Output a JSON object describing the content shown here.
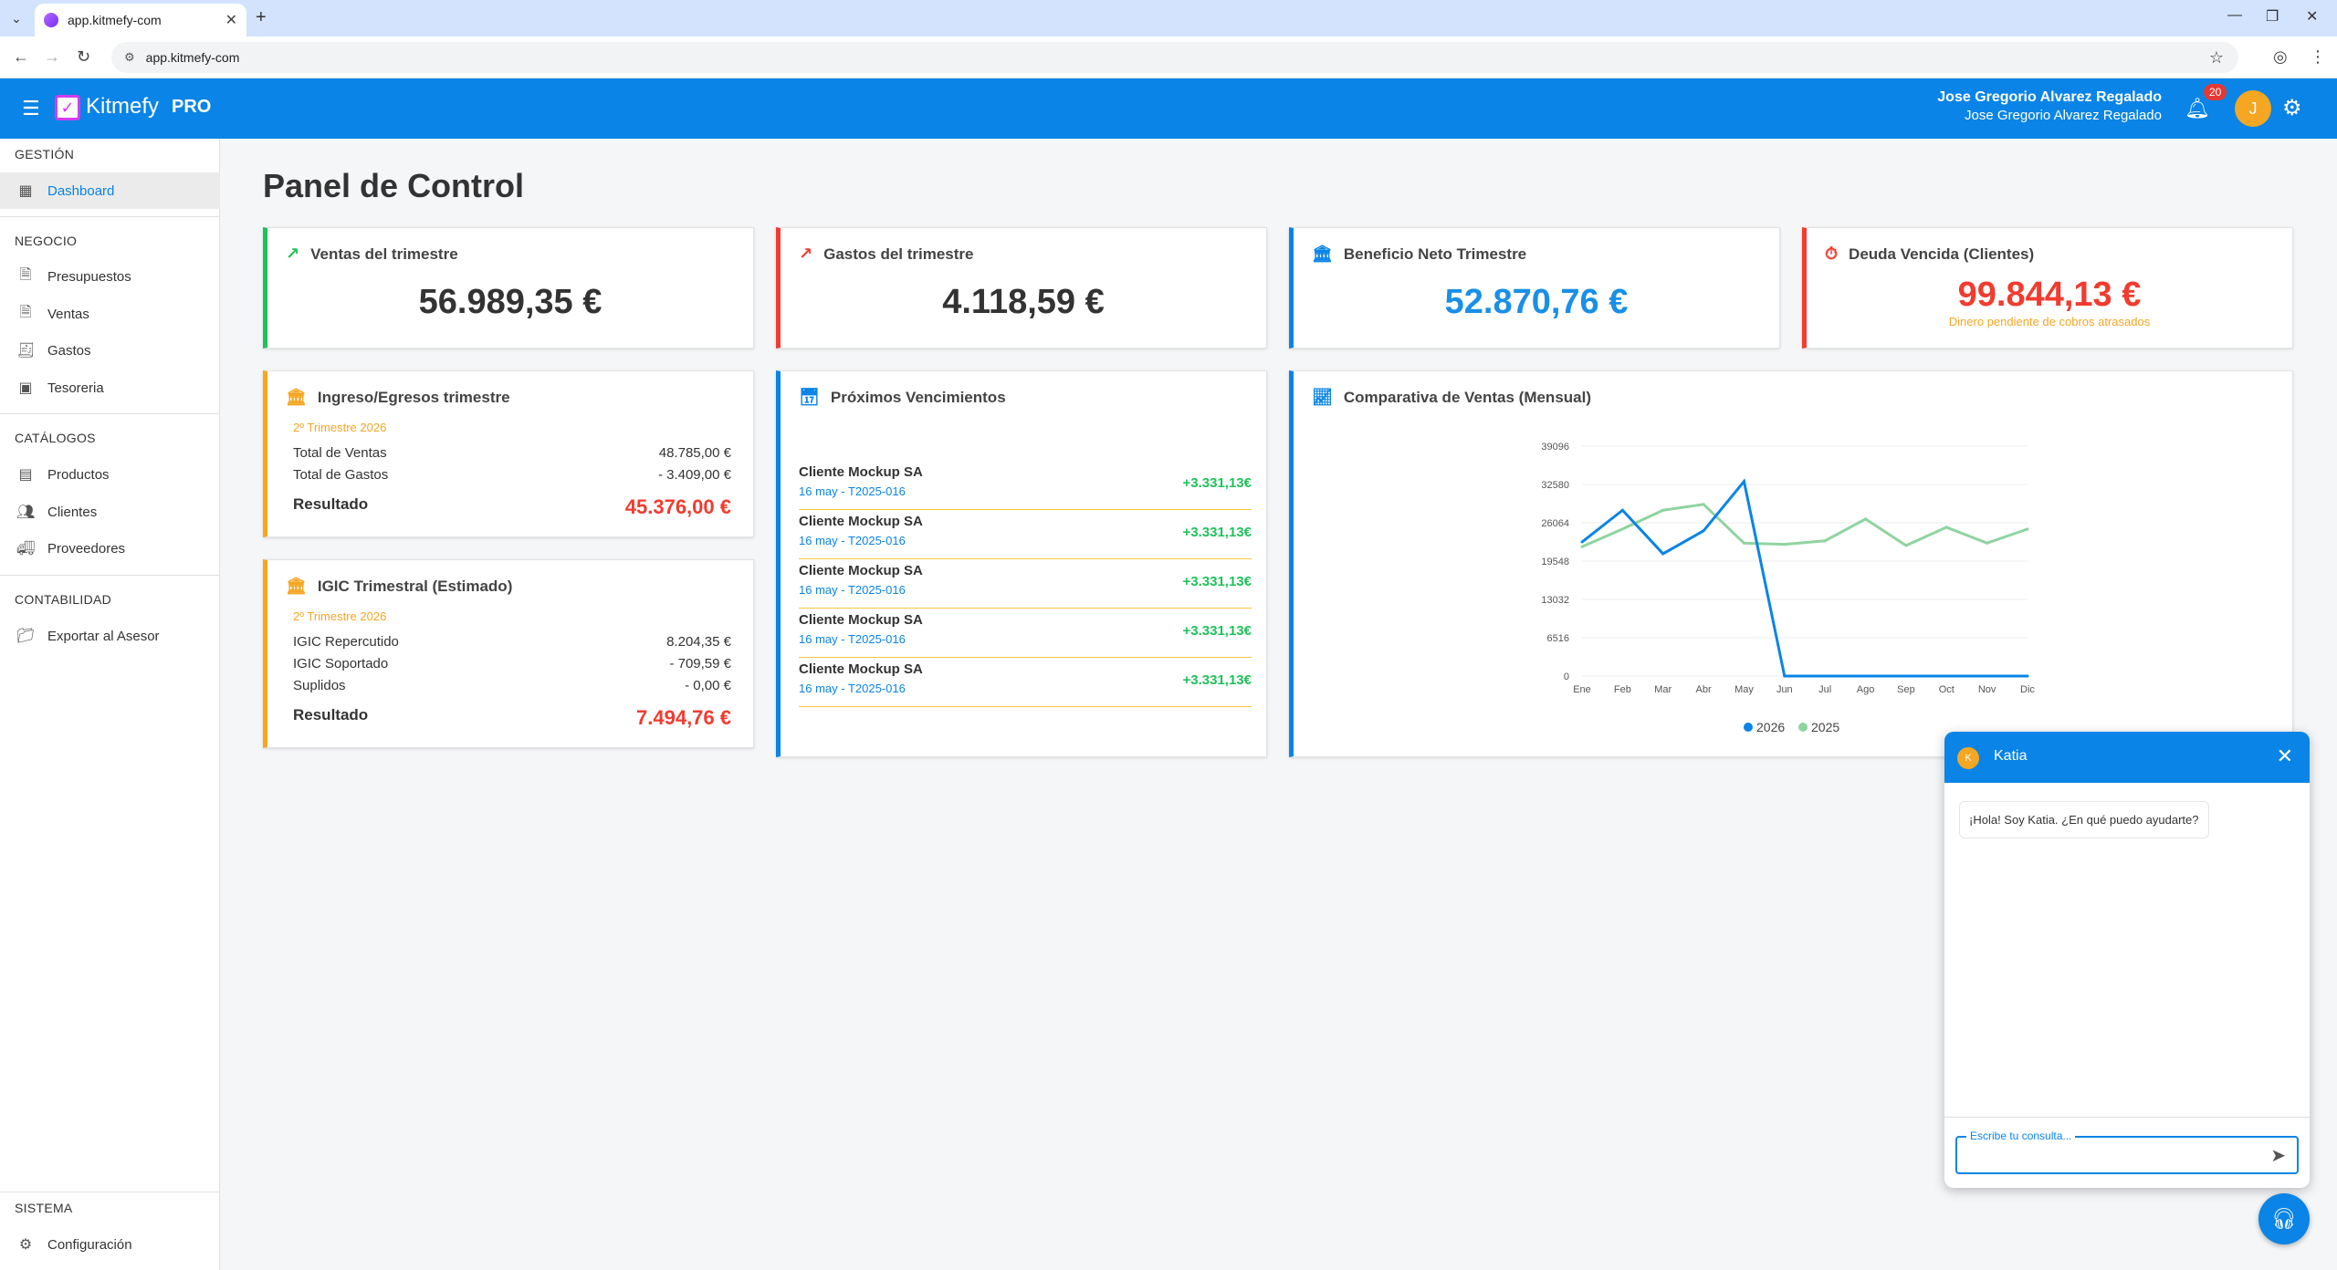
{
  "browser": {
    "tab_title": "app.kitmefy-com",
    "url": "app.kitmefy-com",
    "new_tab": "+",
    "tab_close": "✕"
  },
  "header": {
    "brand": "Kitmefy",
    "pro": "PRO",
    "user_name": "Jose Gregorio Alvarez Regalado",
    "user_sub": "Jose Gregorio Alvarez Regalado",
    "notifications": "20",
    "avatar_letter": "J"
  },
  "sidebar": {
    "sections": {
      "gestion": "GESTIÓN",
      "negocio": "NEGOCIO",
      "catalogos": "CATÁLOGOS",
      "contabilidad": "CONTABILIDAD",
      "sistema": "SISTEMA"
    },
    "items": {
      "dashboard": "Dashboard",
      "presupuestos": "Presupuestos",
      "ventas": "Ventas",
      "gastos": "Gastos",
      "tesoreria": "Tesoreria",
      "productos": "Productos",
      "clientes": "Clientes",
      "proveedores": "Proveedores",
      "exportar": "Exportar al Asesor",
      "configuracion": "Configuración"
    }
  },
  "main": {
    "title": "Panel de Control",
    "kpis": {
      "ventas": {
        "label": "Ventas del trimestre",
        "value": "56.989,35 €"
      },
      "gastos": {
        "label": "Gastos del trimestre",
        "value": "4.118,59 €"
      },
      "beneficio": {
        "label": "Beneficio Neto Trimestre",
        "value": "52.870,76 €"
      },
      "deuda": {
        "label": "Deuda Vencida (Clientes)",
        "value": "99.844,13 €",
        "sub": "Dinero pendiente de cobros atrasados"
      }
    },
    "ingresos": {
      "title": "Ingreso/Egresos trimestre",
      "period": "2º Trimestre 2026",
      "rows": [
        {
          "label": "Total de Ventas",
          "value": "48.785,00 €"
        },
        {
          "label": "Total de Gastos",
          "value": "- 3.409,00 €"
        }
      ],
      "total_label": "Resultado",
      "total_value": "45.376,00 €"
    },
    "igic": {
      "title": "IGIC Trimestral (Estimado)",
      "period": "2º Trimestre 2026",
      "rows": [
        {
          "label": "IGIC Repercutido",
          "value": "8.204,35 €"
        },
        {
          "label": "IGIC Soportado",
          "value": "- 709,59 €"
        },
        {
          "label": "Suplidos",
          "value": "- 0,00 €"
        }
      ],
      "total_label": "Resultado",
      "total_value": "7.494,76 €"
    },
    "vencimientos": {
      "title": "Próximos Vencimientos",
      "items": [
        {
          "name": "Cliente Mockup SA",
          "date": "16 may - T2025-016",
          "amount": "+3.331,13€"
        },
        {
          "name": "Cliente Mockup SA",
          "date": "16 may - T2025-016",
          "amount": "+3.331,13€"
        },
        {
          "name": "Cliente Mockup SA",
          "date": "16 may - T2025-016",
          "amount": "+3.331,13€"
        },
        {
          "name": "Cliente Mockup SA",
          "date": "16 may - T2025-016",
          "amount": "+3.331,13€"
        },
        {
          "name": "Cliente Mockup SA",
          "date": "16 may - T2025-016",
          "amount": "+3.331,13€"
        }
      ]
    },
    "chart_title": "Comparativa de Ventas (Mensual)"
  },
  "chart_data": {
    "type": "line",
    "title": "Comparativa de Ventas (Mensual)",
    "categories": [
      "Ene",
      "Feb",
      "Mar",
      "Abr",
      "May",
      "Jun",
      "Jul",
      "Ago",
      "Sep",
      "Oct",
      "Nov",
      "Dic"
    ],
    "yticks": [
      0,
      6516,
      13032,
      19548,
      26064,
      32580,
      39096
    ],
    "ylim": [
      0,
      39096
    ],
    "series": [
      {
        "name": "2026",
        "color": "#0a84e6",
        "values": [
          22800,
          28200,
          20800,
          24700,
          33100,
          0,
          0,
          0,
          0,
          0,
          0,
          0
        ]
      },
      {
        "name": "2025",
        "color": "#8fd4a0",
        "values": [
          22000,
          25000,
          28200,
          29200,
          22600,
          22400,
          23000,
          26700,
          22200,
          25300,
          22600,
          25000
        ]
      }
    ],
    "legend": "bottom"
  },
  "chat": {
    "name": "Katia",
    "avatar_letter": "K",
    "message": "¡Hola! Soy Katia. ¿En qué puedo ayudarte?",
    "input_label": "Escribe tu consulta..."
  },
  "colors": {
    "primary": "#0a84e6",
    "success": "#1ec25a",
    "danger": "#f23b2f",
    "warning": "#f5a623"
  }
}
